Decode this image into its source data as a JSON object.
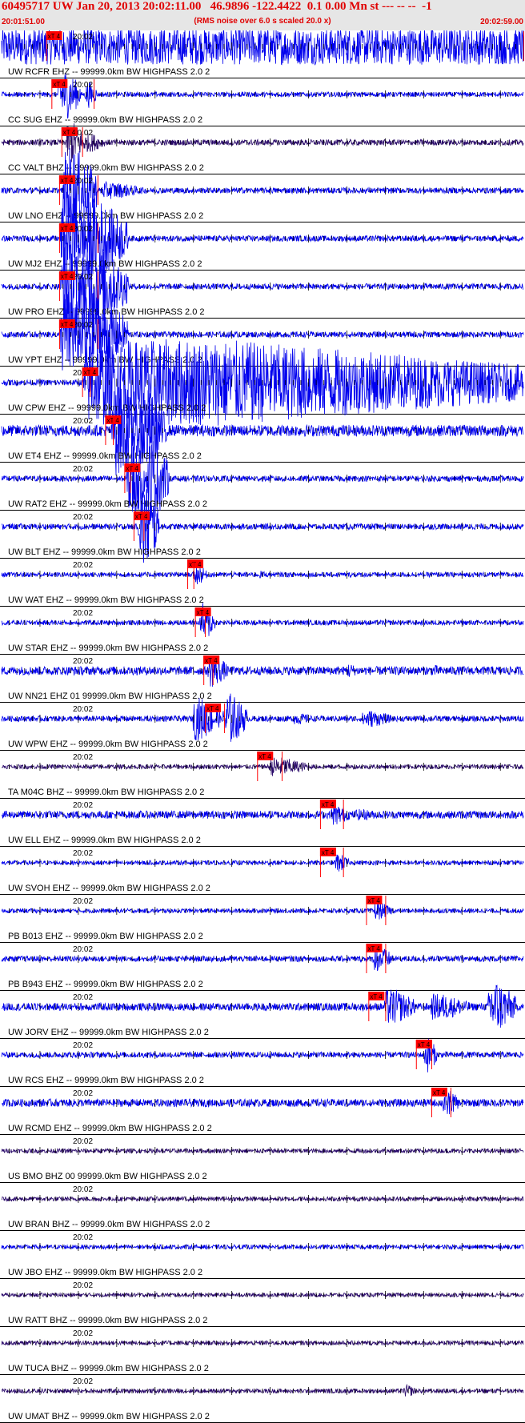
{
  "header": {
    "title": "60495717 UW Jan 20, 2013 20:02:11.00   46.9896 -122.4422  0.1 0.00 Mn st --- -- --  -1",
    "subtitle": "(RMS noise over 6.0 s scaled 20.0 x)",
    "time_start": "20:01:51.00",
    "time_end": "20:02:59.00"
  },
  "colors": {
    "trace_blue": "#0000ee",
    "trace_dark": "#2a0a6a",
    "pick_red": "#ff0000",
    "header_bg": "#e6e6e6",
    "header_text": "#e00000"
  },
  "chart_data": {
    "type": "line",
    "x_axis": {
      "units": "seconds",
      "range": [
        0,
        68
      ],
      "tick_label": "20:02"
    },
    "pick_label": "xT 4",
    "traces": [
      {
        "label": "UW RCFR EHZ -- 99999.0km BW  HIGHPASS  2.0  2",
        "time": "20:02",
        "pick": 5.8,
        "end": 68,
        "amp": 0.38,
        "color": "blue",
        "bursts": [
          [
            6,
            2.6,
            0.34
          ],
          [
            12.5,
            1.2,
            0.22
          ],
          [
            22,
            2.6,
            0.36
          ],
          [
            31,
            2.2,
            0.34
          ],
          [
            40,
            2.5,
            0.36
          ],
          [
            52,
            3.5,
            0.34
          ],
          [
            62,
            3.5,
            0.34
          ]
        ]
      },
      {
        "label": "CC SUG EHZ -- 99999.0km BW  HIGHPASS  2.0  2",
        "time": "20:02",
        "pick": 6.5,
        "end": 12,
        "amp": 0.05,
        "color": "blue",
        "bursts": [
          [
            7.5,
            2.8,
            0.55
          ],
          [
            11,
            1.5,
            0.28
          ]
        ]
      },
      {
        "label": "CC VALT BHZ -- 99999.0km BW  HIGHPASS  2.0  2",
        "time": "20:02",
        "pick": 7.8,
        "end": 10.5,
        "amp": 0.06,
        "color": "dark",
        "bursts": [
          [
            8.5,
            2.5,
            0.45
          ],
          [
            11,
            2.5,
            0.2
          ]
        ]
      },
      {
        "label": "UW LNO EHZ -- 99999.0km BW  HIGHPASS  2.0  2",
        "time": "20:02",
        "pick": 7.5,
        "end": 12.5,
        "amp": 0.06,
        "color": "blue",
        "bursts": [
          [
            8.2,
            4.2,
            0.95
          ],
          [
            13,
            5.5,
            0.18
          ]
        ]
      },
      {
        "label": "UW MJ2 EHZ -- 99999.0km BW  HIGHPASS  2.0  2",
        "time": "20:02",
        "pick": 7.5,
        "end": 12.5,
        "amp": 0.06,
        "color": "blue",
        "bursts": [
          [
            7.8,
            3.5,
            0.95
          ],
          [
            10.5,
            6,
            0.9
          ]
        ]
      },
      {
        "label": "UW PRO EHZ -- 99999.0km BW  HIGHPASS  2.0  2",
        "time": "20:02",
        "pick": 7.5,
        "end": 12.5,
        "amp": 0.06,
        "color": "blue",
        "bursts": [
          [
            7.8,
            3.5,
            0.95
          ],
          [
            10.5,
            6,
            0.9
          ]
        ]
      },
      {
        "label": "UW YPT EHZ -- 99999.0km BW  HIGHPASS  2.0  2",
        "time": "20:02",
        "pick": 7.5,
        "end": 12.5,
        "amp": 0.06,
        "color": "blue",
        "bursts": [
          [
            7.8,
            3.5,
            0.95
          ],
          [
            10.5,
            6,
            0.9
          ]
        ]
      },
      {
        "label": "UW CPW EHZ -- 99999.0km BW  HIGHPASS  2.0  2",
        "time": "20:02",
        "pick": 10.5,
        "end": 11.5,
        "amp": 0.06,
        "color": "blue",
        "bursts": [
          [
            10.8,
            60,
            0.9
          ]
        ]
      },
      {
        "label": "UW ET4 EHZ -- 99999.0km BW  HIGHPASS  2.0  2",
        "time": "20:02",
        "pick": 13.5,
        "end": 14.5,
        "amp": 0.12,
        "color": "blue",
        "bursts": [
          [
            14.5,
            4,
            0.95
          ],
          [
            18,
            3.5,
            0.9
          ]
        ]
      },
      {
        "label": "UW RAT2 EHZ -- 99999.0km BW  HIGHPASS  2.0  2",
        "time": "20:02",
        "pick": 16,
        "end": 16.7,
        "amp": 0.06,
        "color": "blue",
        "bursts": [
          [
            16.5,
            2.2,
            0.95
          ],
          [
            19,
            2.8,
            0.9
          ]
        ]
      },
      {
        "label": "UW BLT EHZ -- 99999.0km BW  HIGHPASS  2.0  2",
        "time": "20:02",
        "pick": 17.2,
        "end": 18.5,
        "amp": 0.06,
        "color": "blue",
        "bursts": [
          [
            18,
            2.5,
            0.95
          ]
        ]
      },
      {
        "label": "UW WAT EHZ -- 99999.0km BW  HIGHPASS  2.0  2",
        "time": "20:02",
        "pick": 24.2,
        "end": 25,
        "amp": 0.05,
        "color": "blue",
        "bursts": [
          [
            25.2,
            1.5,
            0.22
          ],
          [
            33.5,
            1.5,
            0.08
          ]
        ]
      },
      {
        "label": "UW STAR EHZ -- 99999.0km BW  HIGHPASS  2.0  2",
        "time": "20:02",
        "pick": 25.2,
        "end": 26.5,
        "amp": 0.05,
        "color": "blue",
        "bursts": [
          [
            26,
            1.8,
            0.42
          ]
        ]
      },
      {
        "label": "UW NN21 EHZ 01 99999.0km BW  HIGHPASS  2.0  2",
        "time": "20:02",
        "pick": 26.3,
        "end": 27.5,
        "amp": 0.09,
        "color": "blue",
        "bursts": [
          [
            27,
            2.5,
            0.35
          ],
          [
            45,
            1.5,
            0.16
          ],
          [
            56,
            2,
            0.12
          ]
        ]
      },
      {
        "label": "UW WPW EHZ -- 99999.0km BW  HIGHPASS  2.0  2",
        "time": "20:02",
        "pick": 26.5,
        "end": 29,
        "amp": 0.06,
        "color": "blue",
        "bursts": [
          [
            25,
            3.5,
            0.45
          ],
          [
            29,
            3,
            0.55
          ],
          [
            38,
            3,
            0.12
          ],
          [
            47,
            4,
            0.18
          ]
        ]
      },
      {
        "label": "TA M04C BHZ -- 99999.0km BW  HIGHPASS  2.0  2",
        "time": "20:02",
        "pick": 33.3,
        "end": 36.5,
        "amp": 0.045,
        "color": "dark",
        "bursts": [
          [
            35,
            5,
            0.2
          ]
        ]
      },
      {
        "label": "UW ELL EHZ -- 99999.0km BW  HIGHPASS  2.0  2",
        "time": "20:02",
        "pick": 41.5,
        "end": 44.5,
        "amp": 0.08,
        "color": "blue",
        "bursts": [
          [
            43,
            2.5,
            0.22
          ],
          [
            46,
            4,
            0.12
          ]
        ]
      },
      {
        "label": "UW SVOH EHZ -- 99999.0km BW  HIGHPASS  2.0  2",
        "time": "20:02",
        "pick": 41.5,
        "end": 44.5,
        "amp": 0.045,
        "color": "blue",
        "bursts": [
          [
            43.5,
            1.8,
            0.2
          ]
        ]
      },
      {
        "label": "PB B013 EHZ -- 99999.0km BW  HIGHPASS  2.0  2",
        "time": "20:02",
        "pick": 47.5,
        "end": 50,
        "amp": 0.045,
        "color": "blue",
        "bursts": [
          [
            48.5,
            2.5,
            0.18
          ]
        ]
      },
      {
        "label": "PB B943 EHZ -- 99999.0km BW  HIGHPASS  2.0  2",
        "time": "20:02",
        "pick": 47.5,
        "end": 50,
        "amp": 0.06,
        "color": "blue",
        "bursts": [
          [
            48.5,
            2.5,
            0.28
          ]
        ]
      },
      {
        "label": "UW JORV EHZ -- 99999.0km BW  HIGHPASS  2.0  2",
        "time": "20:02",
        "pick": 47.8,
        "end": 50,
        "amp": 0.08,
        "color": "blue",
        "bursts": [
          [
            50,
            4,
            0.38
          ],
          [
            56,
            5,
            0.28
          ],
          [
            63.5,
            3.5,
            0.58
          ]
        ]
      },
      {
        "label": "UW RCS EHZ -- 99999.0km BW  HIGHPASS  2.0  2",
        "time": "20:02",
        "pick": 54,
        "end": 56,
        "amp": 0.06,
        "color": "blue",
        "bursts": [
          [
            55.2,
            1.5,
            0.38
          ]
        ]
      },
      {
        "label": "UW RCMD EHZ -- 99999.0km BW  HIGHPASS  2.0  2",
        "time": "20:02",
        "pick": 56,
        "end": 58.5,
        "amp": 0.08,
        "color": "blue",
        "bursts": [
          [
            57.5,
            2,
            0.32
          ]
        ]
      },
      {
        "label": "US BMO BHZ 00 99999.0km BW  HIGHPASS  2.0  2",
        "time": "20:02",
        "pick": null,
        "end": null,
        "amp": 0.045,
        "color": "dark",
        "bursts": []
      },
      {
        "label": "UW BRAN BHZ -- 99999.0km BW  HIGHPASS  2.0  2",
        "time": "20:02",
        "pick": null,
        "end": null,
        "amp": 0.045,
        "color": "dark",
        "bursts": []
      },
      {
        "label": "UW JBO EHZ -- 99999.0km BW  HIGHPASS  2.0  2",
        "time": "20:02",
        "pick": null,
        "end": null,
        "amp": 0.045,
        "color": "blue",
        "bursts": []
      },
      {
        "label": "UW RATT BHZ -- 99999.0km BW  HIGHPASS  2.0  2",
        "time": "20:02",
        "pick": null,
        "end": null,
        "amp": 0.04,
        "color": "dark",
        "bursts": []
      },
      {
        "label": "UW TUCA BHZ -- 99999.0km BW  HIGHPASS  2.0  2",
        "time": "20:02",
        "pick": null,
        "end": null,
        "amp": 0.045,
        "color": "dark",
        "bursts": []
      },
      {
        "label": "UW UMAT BHZ -- 99999.0km BW  HIGHPASS  2.0  2",
        "time": "20:02",
        "pick": null,
        "end": null,
        "amp": 0.045,
        "color": "dark",
        "bursts": [
          [
            52.5,
            1.5,
            0.14
          ]
        ]
      }
    ]
  }
}
